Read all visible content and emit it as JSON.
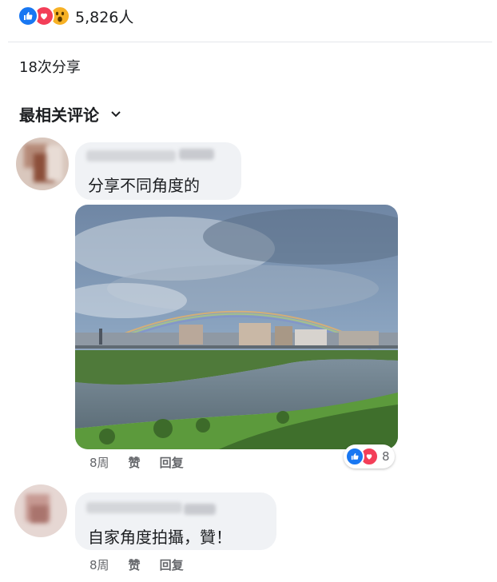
{
  "post": {
    "reactions": {
      "icons": [
        "like-icon",
        "love-icon",
        "wow-icon"
      ],
      "total": "5,826人"
    },
    "shares": "18次分享"
  },
  "comments_section": {
    "sort_label": "最相关评论"
  },
  "comments": [
    {
      "text": "分享不同角度的",
      "has_photo": true,
      "photo_description_icon": "rainbow-photo",
      "time": "8周",
      "like_label": "赞",
      "reply_label": "回复",
      "reaction_count": "8",
      "reaction_icons": [
        "like-icon",
        "love-icon"
      ]
    },
    {
      "text": "自家角度拍攝，贊！",
      "has_photo": false,
      "time": "8周",
      "like_label": "赞",
      "reply_label": "回复"
    }
  ],
  "colors": {
    "like_blue": "#1877f2",
    "love_red": "#f33e58",
    "wow_yellow": "#f7b125",
    "bubble_gray": "#f0f2f5",
    "meta_gray": "#65676b"
  }
}
